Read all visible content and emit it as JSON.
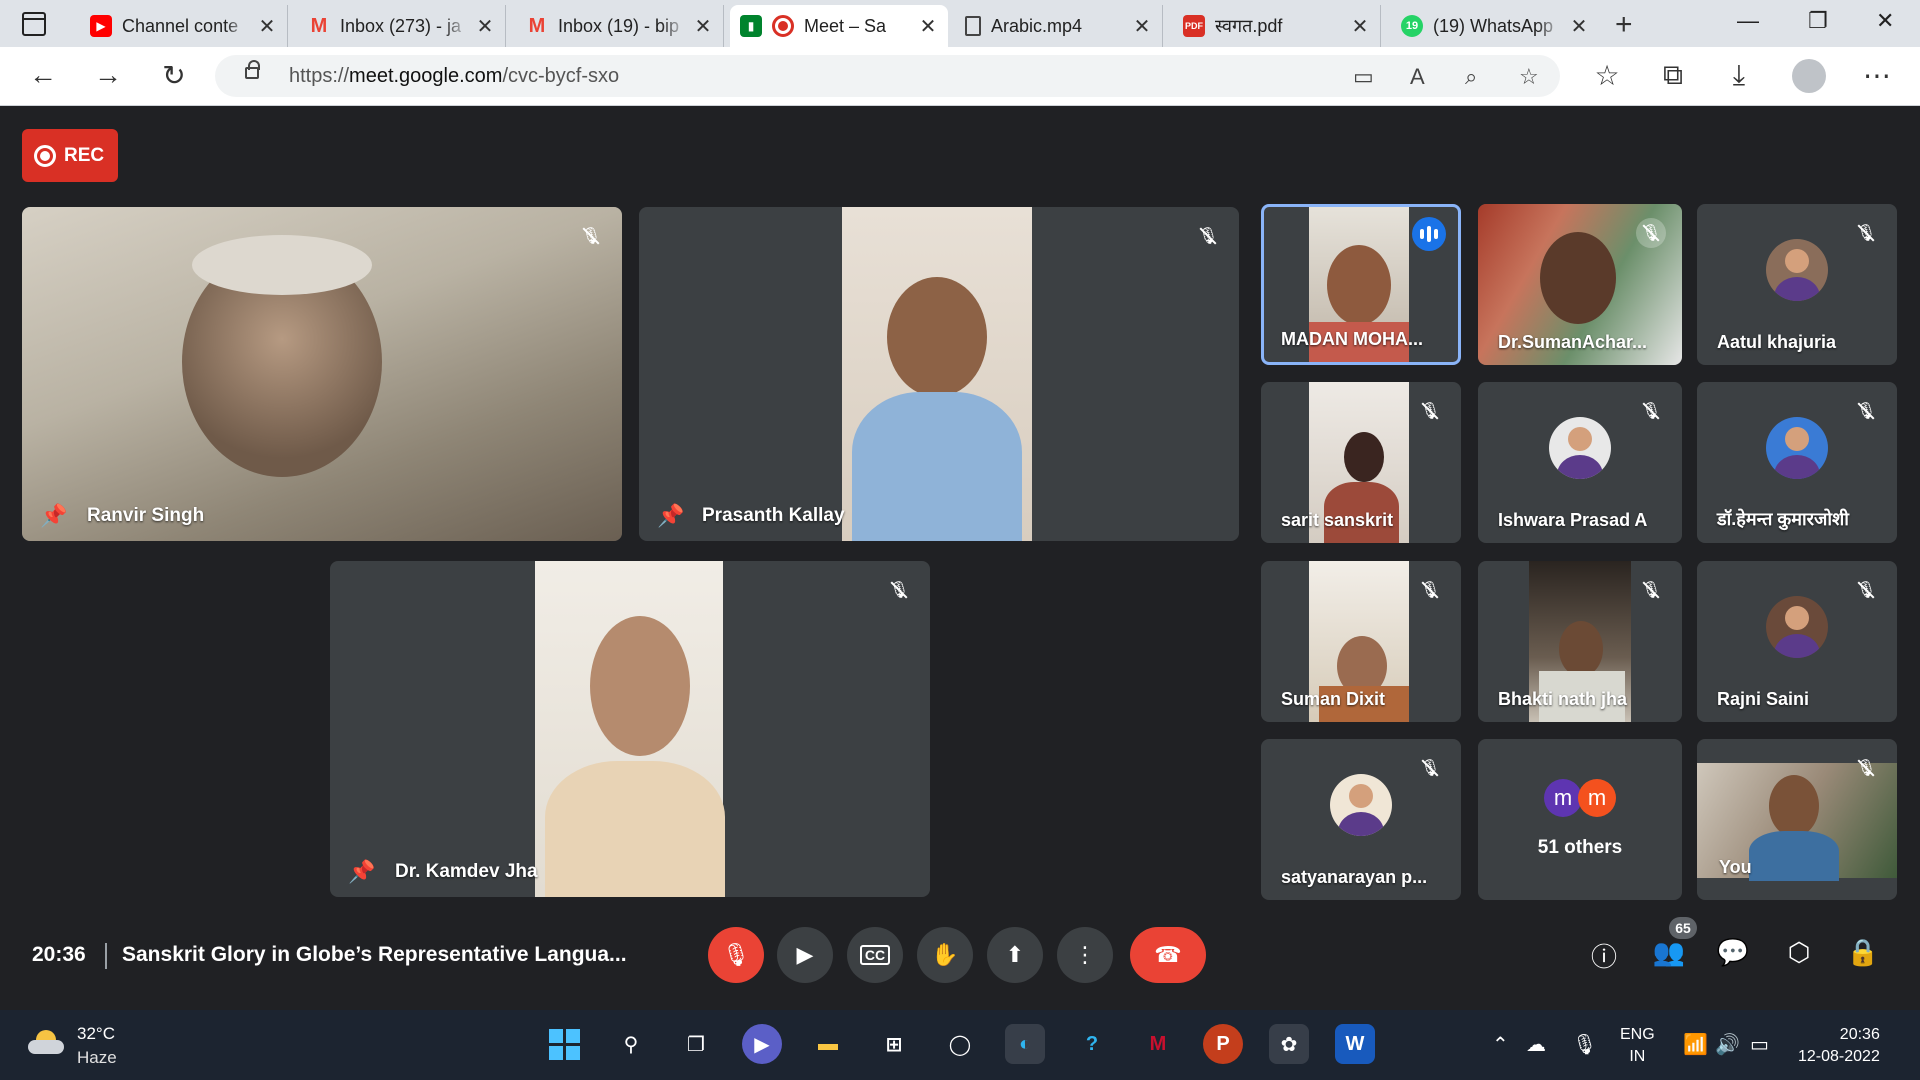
{
  "browser": {
    "tabs": [
      {
        "title": "Channel conte",
        "icon": "youtube-icon",
        "color": "#ff0000"
      },
      {
        "title": "Inbox (273) - ja",
        "icon": "gmail-icon",
        "color": "#ea4335"
      },
      {
        "title": "Inbox (19) - bip",
        "icon": "gmail-icon",
        "color": "#ea4335"
      },
      {
        "title": "Meet – Sa",
        "icon": "meet-icon",
        "color": "#00832d"
      },
      {
        "title": "Arabic.mp4",
        "icon": "file-icon",
        "color": "#444444"
      },
      {
        "title": "स्वगत.pdf",
        "icon": "pdf-icon",
        "color": "#d93025"
      },
      {
        "title": "(19) WhatsApp",
        "icon": "whatsapp-icon",
        "color": "#25d366",
        "badge": "19"
      }
    ],
    "url_prefix": "https://",
    "url_domain": "meet.google.com",
    "url_path": "/cvc-bycf-sxo"
  },
  "meet": {
    "rec_label": "REC",
    "main_tiles": [
      {
        "name": "Ranvir Singh"
      },
      {
        "name": "Prasanth Kallay"
      },
      {
        "name": "Dr. Kamdev Jha"
      }
    ],
    "grid": [
      {
        "name": "MADAN MOHA..."
      },
      {
        "name": "Dr.SumanAchar..."
      },
      {
        "name": "Aatul khajuria"
      },
      {
        "name": "sarit sanskrit"
      },
      {
        "name": "Ishwara Prasad A"
      },
      {
        "name": "डॉ.हेमन्त कुमारजोशी"
      },
      {
        "name": "Suman Dixit"
      },
      {
        "name": "Bhakti nath jha"
      },
      {
        "name": "Rajni Saini"
      },
      {
        "name": "satyanarayan p..."
      },
      {
        "name": "You"
      }
    ],
    "others": {
      "badge1": "m",
      "badge2": "m",
      "label": "51 others"
    },
    "time": "20:36",
    "title": "Sanskrit Glory in Globe’s Representative Langua...",
    "participants_count": "65",
    "colors": {
      "accent": "#1a73e8",
      "danger": "#ea4335",
      "tile": "#3c4043",
      "bg": "#202124"
    }
  },
  "taskbar": {
    "temp": "32°C",
    "weather": "Haze",
    "lang1": "ENG",
    "lang2": "IN",
    "time": "20:36",
    "date": "12-08-2022"
  }
}
